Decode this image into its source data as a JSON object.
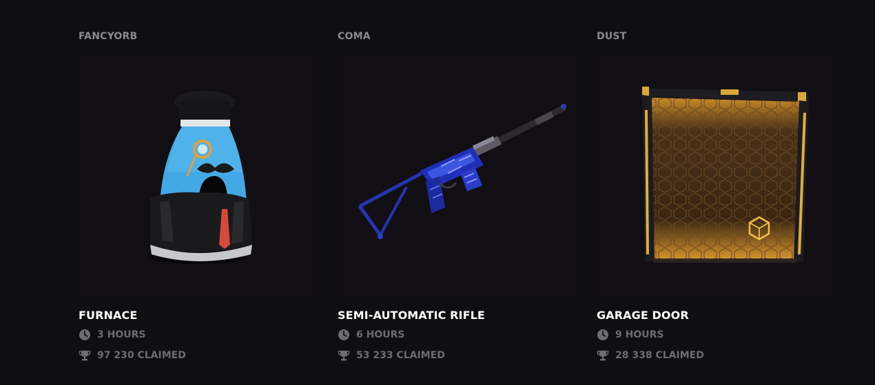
{
  "items": [
    {
      "creator": "FANCYORB",
      "name": "FURNACE",
      "duration": "3 HOURS",
      "claimed": "97 230 CLAIMED",
      "icon": "furnace-skin"
    },
    {
      "creator": "COMA",
      "name": "SEMI-AUTOMATIC RIFLE",
      "duration": "6 HOURS",
      "claimed": "53 233 CLAIMED",
      "icon": "rifle-skin"
    },
    {
      "creator": "DUST",
      "name": "GARAGE DOOR",
      "duration": "9 HOURS",
      "claimed": "28 338 CLAIMED",
      "icon": "garage-door-skin"
    }
  ],
  "meta_icons": {
    "duration": "clock-icon",
    "claimed": "trophy-icon"
  },
  "colors": {
    "background": "#0f0e10",
    "card_background": "#120f14",
    "title": "#ffffff",
    "creator": "#8c8a8e",
    "meta": "#6e6c70"
  }
}
